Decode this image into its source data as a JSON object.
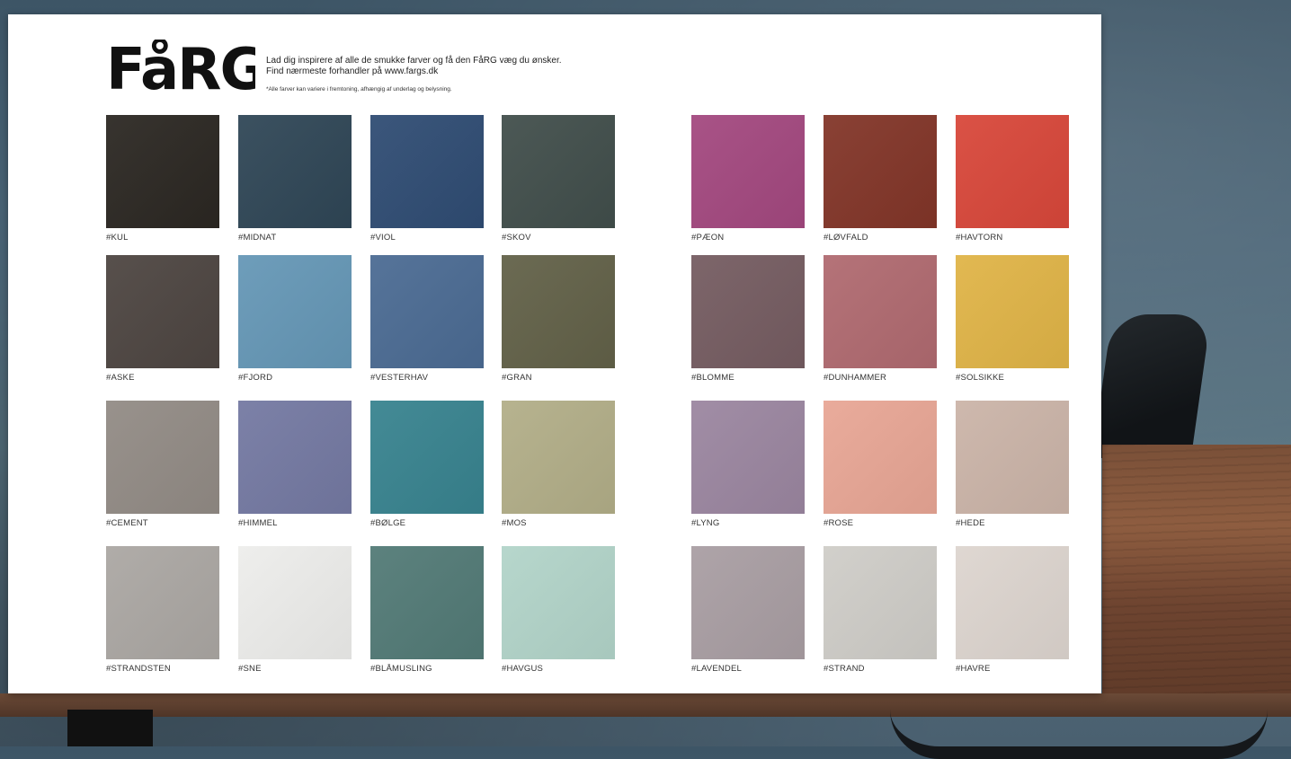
{
  "brand": "FåRG",
  "intro": {
    "line1": "Lad dig inspirere af alle de smukke farver og få den FåRG væg du ønsker.",
    "line2": "Find nærmeste forhandler på www.fargs.dk"
  },
  "note": "*Alle farver kan variere i fremtoning, afhængig af underlag og belysning.",
  "swatches": [
    {
      "label": "#KUL",
      "color": "#2b2722"
    },
    {
      "label": "#MIDNAT",
      "color": "#2f4656"
    },
    {
      "label": "#VIOL",
      "color": "#2f4c73"
    },
    {
      "label": "#SKOV",
      "color": "#414e4b"
    },
    {
      "label": "#PÆON",
      "color": "#a3487f"
    },
    {
      "label": "#LØVFALD",
      "color": "#823528"
    },
    {
      "label": "#HAVTORN",
      "color": "#d8473a"
    },
    {
      "label": "#ASKE",
      "color": "#4d4541"
    },
    {
      "label": "#FJORD",
      "color": "#6597b6"
    },
    {
      "label": "#VESTERHAV",
      "color": "#4b6b93"
    },
    {
      "label": "#GRAN",
      "color": "#626148"
    },
    {
      "label": "#BLOMME",
      "color": "#755c61"
    },
    {
      "label": "#DUNHAMMER",
      "color": "#b06a70"
    },
    {
      "label": "#SOLSIKKE",
      "color": "#e0b447"
    },
    {
      "label": "#CEMENT",
      "color": "#928b85"
    },
    {
      "label": "#HIMMEL",
      "color": "#7479a2"
    },
    {
      "label": "#BØLGE",
      "color": "#38838f"
    },
    {
      "label": "#MOS",
      "color": "#b2ae88"
    },
    {
      "label": "#LYNG",
      "color": "#9b86a0"
    },
    {
      "label": "#ROSE",
      "color": "#e8a695"
    },
    {
      "label": "#HEDE",
      "color": "#cbb4a8"
    },
    {
      "label": "#STRANDSTEN",
      "color": "#aba7a3"
    },
    {
      "label": "#SNE",
      "color": "#ededeb"
    },
    {
      "label": "#BLÅMUSLING",
      "color": "#527a76"
    },
    {
      "label": "#HAVGUS",
      "color": "#b2d4c9"
    },
    {
      "label": "#LAVENDEL",
      "color": "#a99ea3"
    },
    {
      "label": "#STRAND",
      "color": "#cfcdc8"
    },
    {
      "label": "#HAVRE",
      "color": "#ddd5cf"
    }
  ]
}
